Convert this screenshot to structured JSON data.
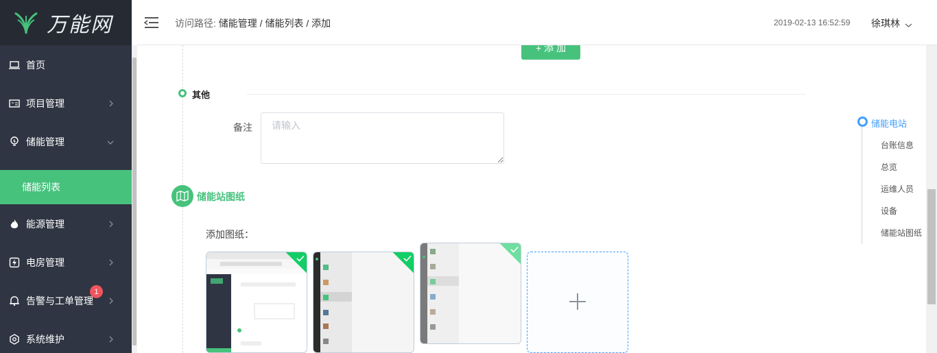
{
  "brand": {
    "name": "万能网"
  },
  "sidebar": {
    "items": [
      {
        "label": "首页",
        "icon": "laptop-icon"
      },
      {
        "label": "项目管理",
        "icon": "id-card-icon"
      },
      {
        "label": "储能管理",
        "icon": "bulb-icon"
      },
      {
        "label": "储能列表"
      },
      {
        "label": "能源管理",
        "icon": "flame-icon"
      },
      {
        "label": "电房管理",
        "icon": "bolt-icon"
      },
      {
        "label": "告警与工单管理",
        "icon": "bell-icon",
        "badge": "1"
      },
      {
        "label": "系统维护",
        "icon": "gear-icon"
      }
    ]
  },
  "header": {
    "breadcrumb_prefix": "访问路径:",
    "crumb1": "储能管理",
    "sep": "/",
    "crumb2": "储能列表",
    "crumb3": "添加",
    "timestamp": "2019-02-13 16:52:59",
    "user": "徐琪林"
  },
  "main": {
    "add_button": "+ 添 加",
    "other_title": "其他",
    "remark_label": "备注",
    "remark_placeholder": "请输入",
    "drawings_title": "储能站图纸",
    "add_drawing_label": "添加图纸："
  },
  "anchor": {
    "head": "储能电站",
    "links": [
      "台账信息",
      "总览",
      "运维人员",
      "设备",
      "储能站图纸"
    ]
  },
  "colors": {
    "accent": "#47c27d",
    "sidebar": "#2f3542",
    "link": "#409eff",
    "badge": "#f0555d"
  }
}
